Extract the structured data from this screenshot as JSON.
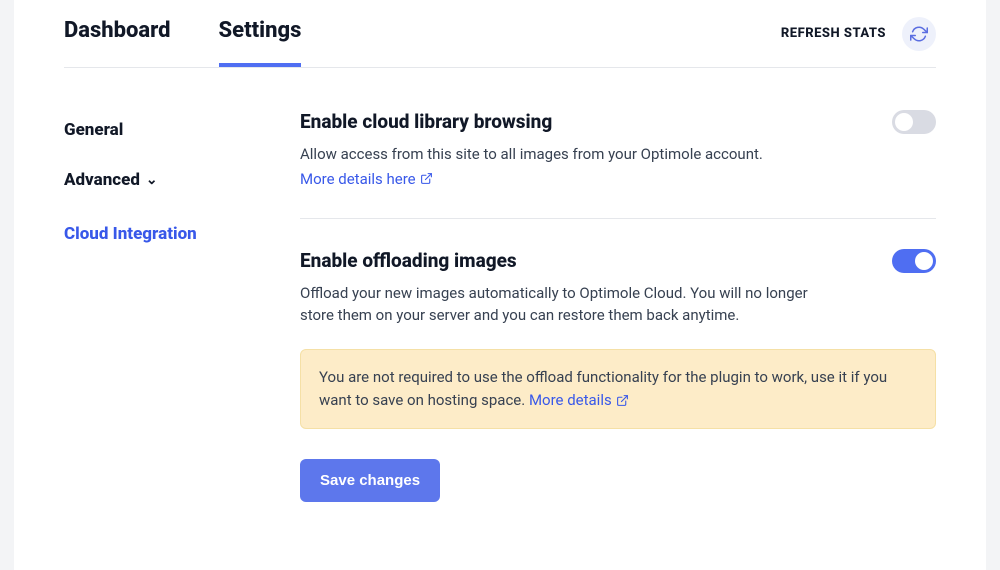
{
  "tabs": {
    "dashboard": "Dashboard",
    "settings": "Settings"
  },
  "refresh": {
    "label": "REFRESH STATS"
  },
  "sidebar": {
    "general": "General",
    "advanced": "Advanced",
    "cloud_integration": "Cloud Integration"
  },
  "settings": {
    "cloud_library": {
      "title": "Enable cloud library browsing",
      "desc": "Allow access from this site to all images from your Optimole account.",
      "link": "More details here",
      "enabled": false
    },
    "offload": {
      "title": "Enable offloading images",
      "desc": "Offload your new images automatically to Optimole Cloud. You will no longer store them on your server and you can restore them back anytime.",
      "notice": "You are not required to use the offload functionality for the plugin to work, use it if you want to save on hosting space.",
      "notice_link": "More details",
      "enabled": true
    }
  },
  "buttons": {
    "save": "Save changes"
  }
}
